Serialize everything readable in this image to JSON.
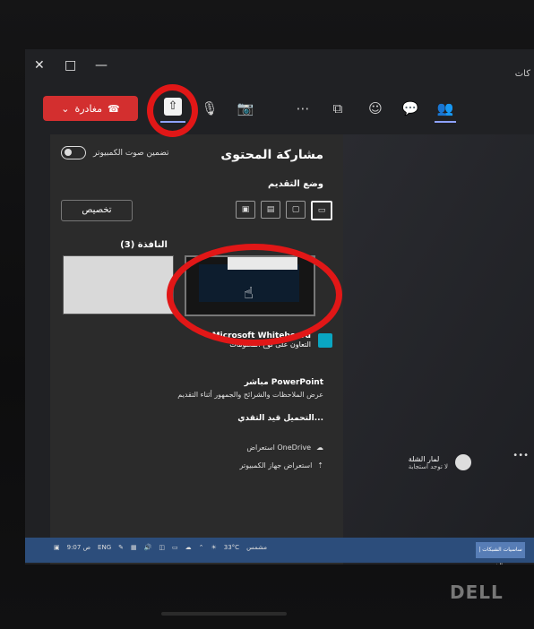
{
  "window": {
    "close": "✕",
    "restore": "□",
    "minimize": "—",
    "top_right": "كات"
  },
  "toolbar": {
    "leave_label": "مغادرة",
    "leave_dropdown": "⌄"
  },
  "panel": {
    "title": "مشاركة المحتوى",
    "include_audio": "تضمين صوت الكمبيوتر",
    "presenter_mode": "وضع التقديم",
    "customize": "تخصيص",
    "window_label": "النافذة (3)",
    "whiteboard_name": "Microsoft Whiteboard",
    "whiteboard_sub": "التعاون على لوح المعلومات",
    "powerpoint_title": "مباشر PowerPoint",
    "powerpoint_sub": "عرض الملاحظات والشرائح والجمهور أثناء التقديم",
    "upload_in_progress": "التحميل قيد التقدي...",
    "onedrive": "استعراض OneDrive",
    "computer": "استعراض جهاز الكمبيوتر"
  },
  "user": {
    "name": "لمار الشلة",
    "status": "لا توجد استجابة"
  },
  "taskbar": {
    "language": "ENG",
    "time": "9:07 ص",
    "temperature": "33°C",
    "weather": "مشمس",
    "app": "ساسيات الشبكات | الشـ..."
  },
  "brand": "DELL"
}
